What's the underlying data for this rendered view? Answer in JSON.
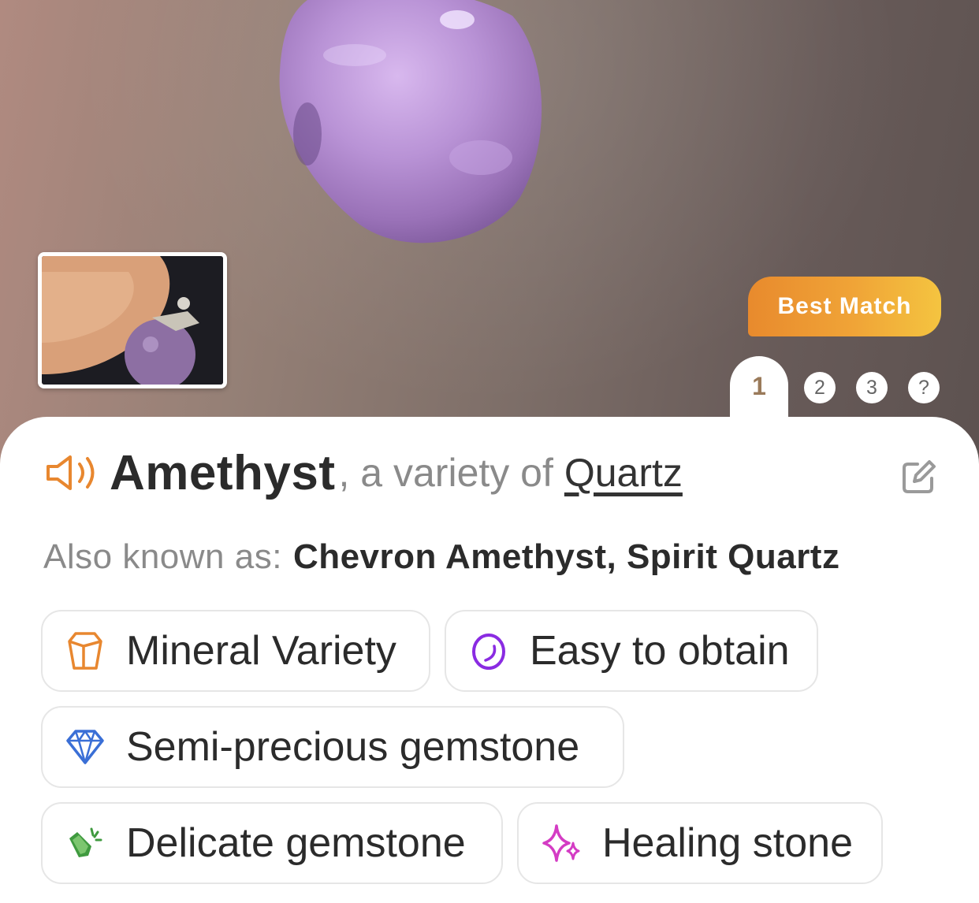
{
  "hero": {
    "badge": "Best Match",
    "pager": {
      "active": "1",
      "pages": [
        "2",
        "3",
        "?"
      ]
    }
  },
  "result": {
    "name": "Amethyst",
    "variety_prefix": ", a variety of",
    "variety_link": "Quartz",
    "aka_label": "Also known as:",
    "aka_value": "Chevron Amethyst, Spirit Quartz"
  },
  "tags": [
    {
      "label": "Mineral Variety",
      "icon": "crystal-outline-icon",
      "color": "#e8872f"
    },
    {
      "label": "Easy to obtain",
      "icon": "circle-swirl-icon",
      "color": "#8a2be2"
    },
    {
      "label": "Semi-precious gemstone",
      "icon": "diamond-icon",
      "color": "#3a6fd6"
    },
    {
      "label": "Delicate gemstone",
      "icon": "broken-crystal-icon",
      "color": "#3f9a3f"
    },
    {
      "label": "Healing stone",
      "icon": "sparkles-icon",
      "color": "#d43cc4"
    }
  ],
  "colors": {
    "accent_orange": "#e8872f",
    "title": "#2b2b2b",
    "muted": "#8a8a8a"
  }
}
